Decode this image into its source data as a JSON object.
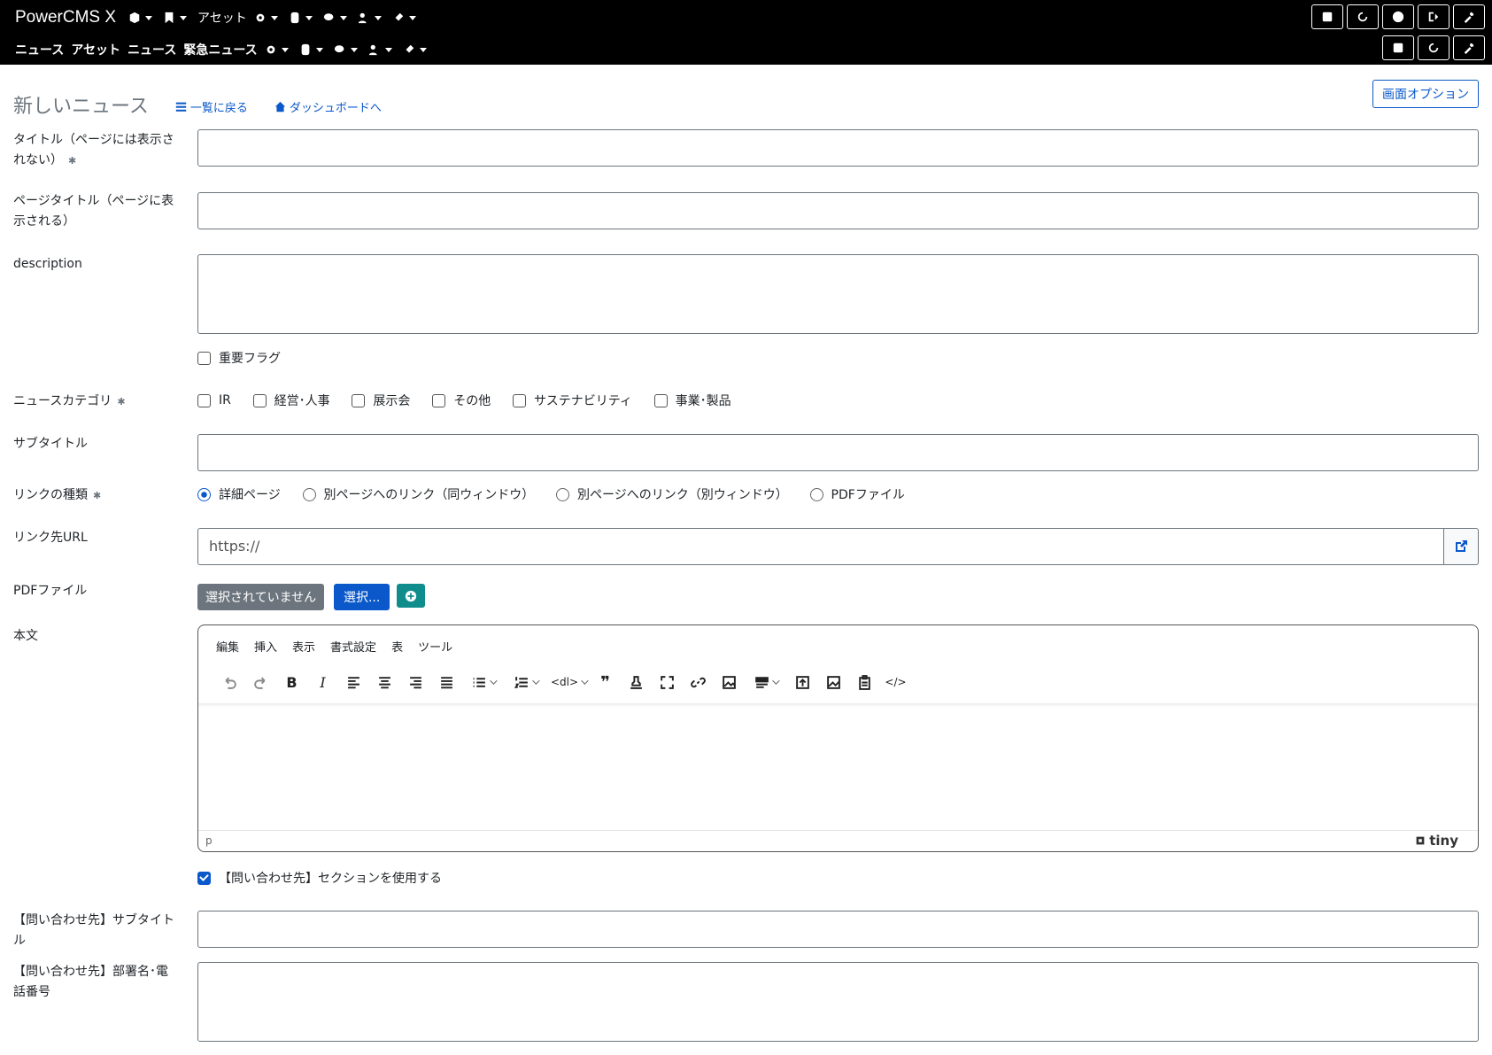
{
  "topbar": {
    "brand": "PowerCMS X",
    "row1_asset": "アセット",
    "row2_items": [
      "ニュース",
      "アセット",
      "ニュース",
      "緊急ニュース"
    ]
  },
  "header": {
    "title": "新しいニュース",
    "back_link": "一覧に戻る",
    "dashboard_link": "ダッシュボードへ",
    "screen_options": "画面オプション"
  },
  "form": {
    "title_label": "タイトル（ページには表示されない）",
    "page_title_label": "ページタイトル（ページに表示される）",
    "description_label": "description",
    "important_flag": "重要フラグ",
    "category_label": "ニュースカテゴリ",
    "categories": [
      "IR",
      "経営･人事",
      "展示会",
      "その他",
      "サステナビリティ",
      "事業･製品"
    ],
    "subtitle_label": "サブタイトル",
    "link_type_label": "リンクの種類",
    "link_types": [
      "詳細ページ",
      "別ページへのリンク（同ウィンドウ）",
      "別ページへのリンク（別ウィンドウ）",
      "PDFファイル"
    ],
    "link_type_selected": "詳細ページ",
    "link_url_label": "リンク先URL",
    "link_url_value": "https://",
    "pdf_label": "PDFファイル",
    "pdf_none": "選択されていません",
    "pdf_select": "選択...",
    "body_label": "本文",
    "editor_menu": [
      "編集",
      "挿入",
      "表示",
      "書式設定",
      "表",
      "ツール"
    ],
    "editor_dl": "<dl>",
    "editor_code": "</>",
    "editor_path": "p",
    "editor_brand": "tiny",
    "contact_toggle": "【問い合わせ先】セクションを使用する",
    "contact_subtitle_label": "【問い合わせ先】サブタイトル",
    "contact_dept_label": "【問い合わせ先】部署名･電話番号"
  },
  "required_mark": "✱"
}
